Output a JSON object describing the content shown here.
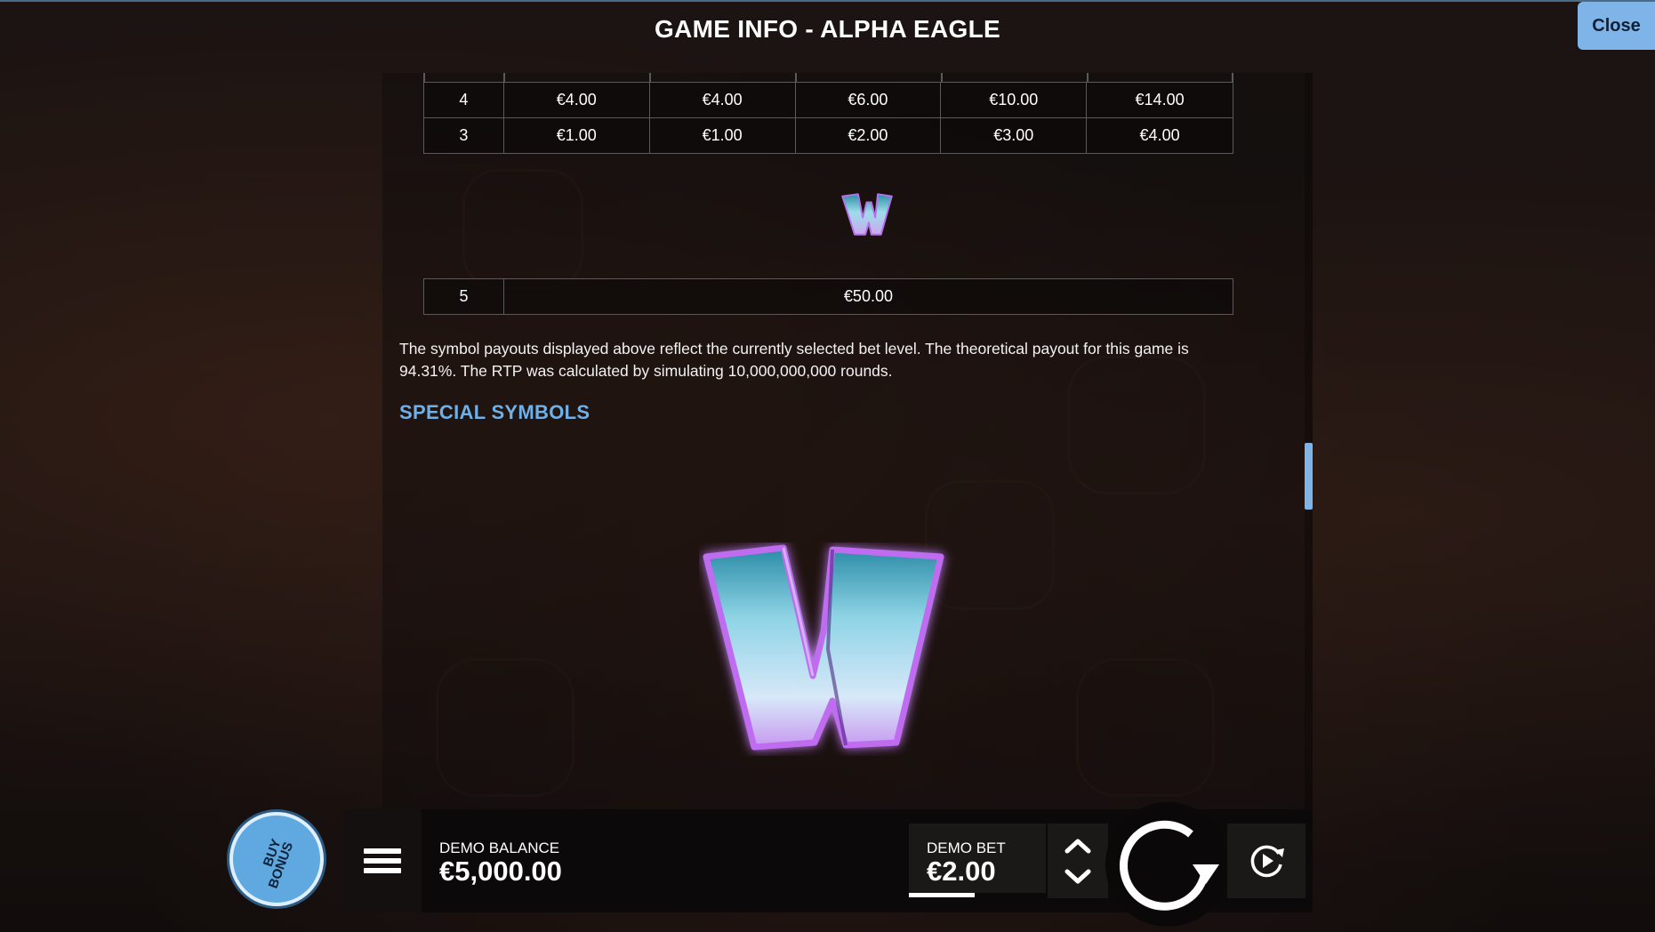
{
  "header": {
    "title": "GAME INFO - ALPHA EAGLE",
    "close_label": "Close"
  },
  "paytable_top": {
    "rows": [
      {
        "count": "4",
        "values": [
          "€4.00",
          "€4.00",
          "€6.00",
          "€10.00",
          "€14.00"
        ]
      },
      {
        "count": "3",
        "values": [
          "€1.00",
          "€1.00",
          "€2.00",
          "€3.00",
          "€4.00"
        ]
      }
    ]
  },
  "wild_table": {
    "symbol_icon": "wild-w-icon",
    "rows": [
      {
        "count": "5",
        "value": "€50.00"
      }
    ]
  },
  "rtp_text": "The symbol payouts displayed above reflect the currently selected bet level. The theoretical payout for this game is 94.31%. The RTP was calculated by simulating 10,000,000,000 rounds.",
  "special_symbols": {
    "heading": "SPECIAL SYMBOLS",
    "icon": "wild-w-icon"
  },
  "bottom_bar": {
    "buy_bonus_line1": "BUY",
    "buy_bonus_line2": "BONUS",
    "menu_icon": "hamburger-menu-icon",
    "balance_label": "DEMO BALANCE",
    "balance_value": "€5,000.00",
    "bet_label": "DEMO BET",
    "bet_value": "€2.00",
    "spin_icon": "spin-icon",
    "autoplay_icon": "autoplay-icon"
  },
  "colors": {
    "accent": "#7fb4e8",
    "heading_blue": "#6fb0e8",
    "background": "#16100f"
  }
}
